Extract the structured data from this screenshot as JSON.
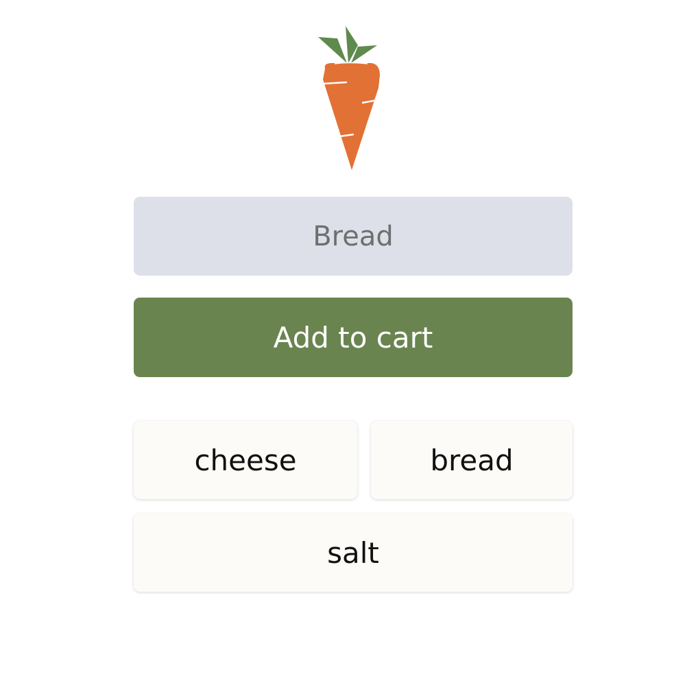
{
  "logo": {
    "icon": "carrot-icon",
    "colors": {
      "body": "#e27135",
      "leaves": "#5f8a4d"
    }
  },
  "input": {
    "value": "",
    "placeholder": "Bread"
  },
  "add_button": {
    "label": "Add to cart",
    "color": "#6a8450"
  },
  "items": [
    {
      "label": "cheese"
    },
    {
      "label": "bread"
    },
    {
      "label": "salt"
    }
  ]
}
